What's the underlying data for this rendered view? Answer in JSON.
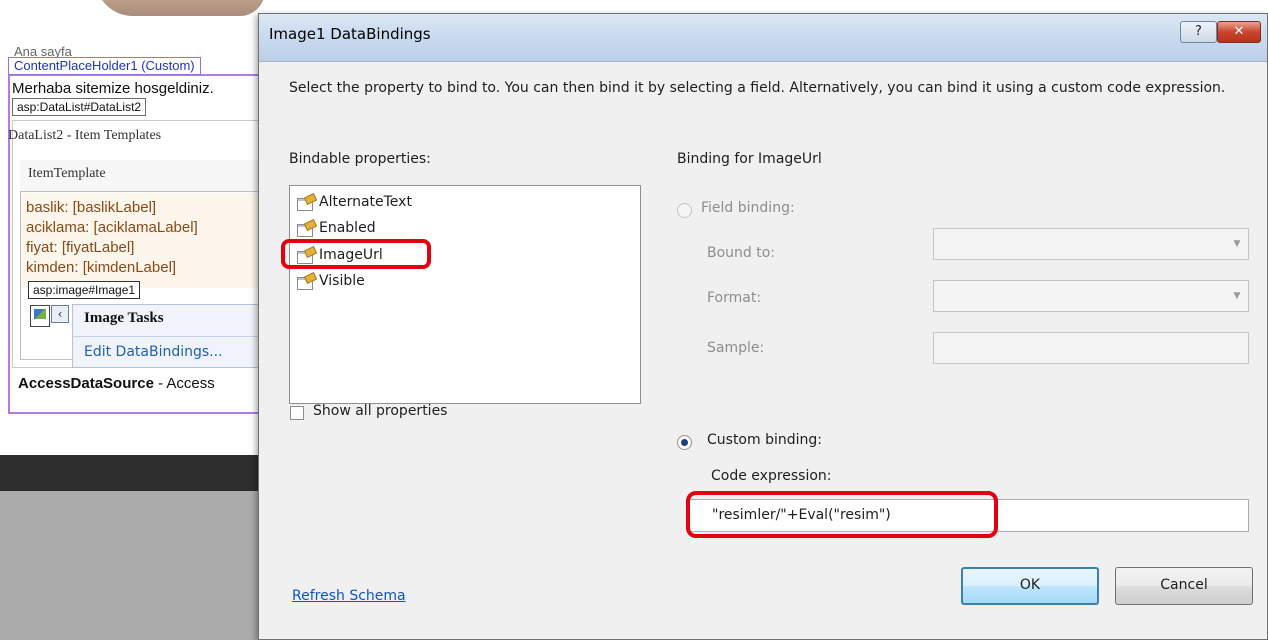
{
  "designer": {
    "page_label": "Ana sayfa",
    "content_placeholder_tag": "ContentPlaceHolder1 (Custom)",
    "welcome_text": "Merhaba sitemize hosgeldiniz.",
    "datalist_tag": "asp:DataList#DataList2",
    "datalist_header": "DataList2 - Item Templates",
    "item_template_header": "ItemTemplate",
    "template_lines": [
      "baslik: [baslikLabel]",
      "aciklama: [aciklamaLabel]",
      "fiyat: [fiyatLabel]",
      "kimden: [kimdenLabel]"
    ],
    "image_tag": "asp:image#Image1",
    "tasks_title": "Image Tasks",
    "tasks_link": "Edit DataBindings...",
    "datasource_bold": "AccessDataSource",
    "datasource_rest": " - Access"
  },
  "dialog": {
    "title": "Image1 DataBindings",
    "help_glyph": "?",
    "close_glyph": "✕",
    "instructions": "Select the property to bind to. You can then bind it by selecting a field. Alternatively, you can bind it using a custom code expression.",
    "bindable_label": "Bindable properties:",
    "properties": [
      "AlternateText",
      "Enabled",
      "ImageUrl",
      "Visible"
    ],
    "selected_property": "ImageUrl",
    "show_all_label": "Show all properties",
    "show_all_checked": false,
    "binding_for_label": "Binding for ImageUrl",
    "field_binding_label": "Field binding:",
    "bound_to_label": "Bound to:",
    "format_label": "Format:",
    "sample_label": "Sample:",
    "custom_binding_label": "Custom binding:",
    "code_expression_label": "Code expression:",
    "code_expression_value": "\"resimler/\"+Eval(\"resim\")",
    "refresh_link": "Refresh Schema",
    "ok_label": "OK",
    "cancel_label": "Cancel",
    "highlight_color": "#e3000f"
  }
}
